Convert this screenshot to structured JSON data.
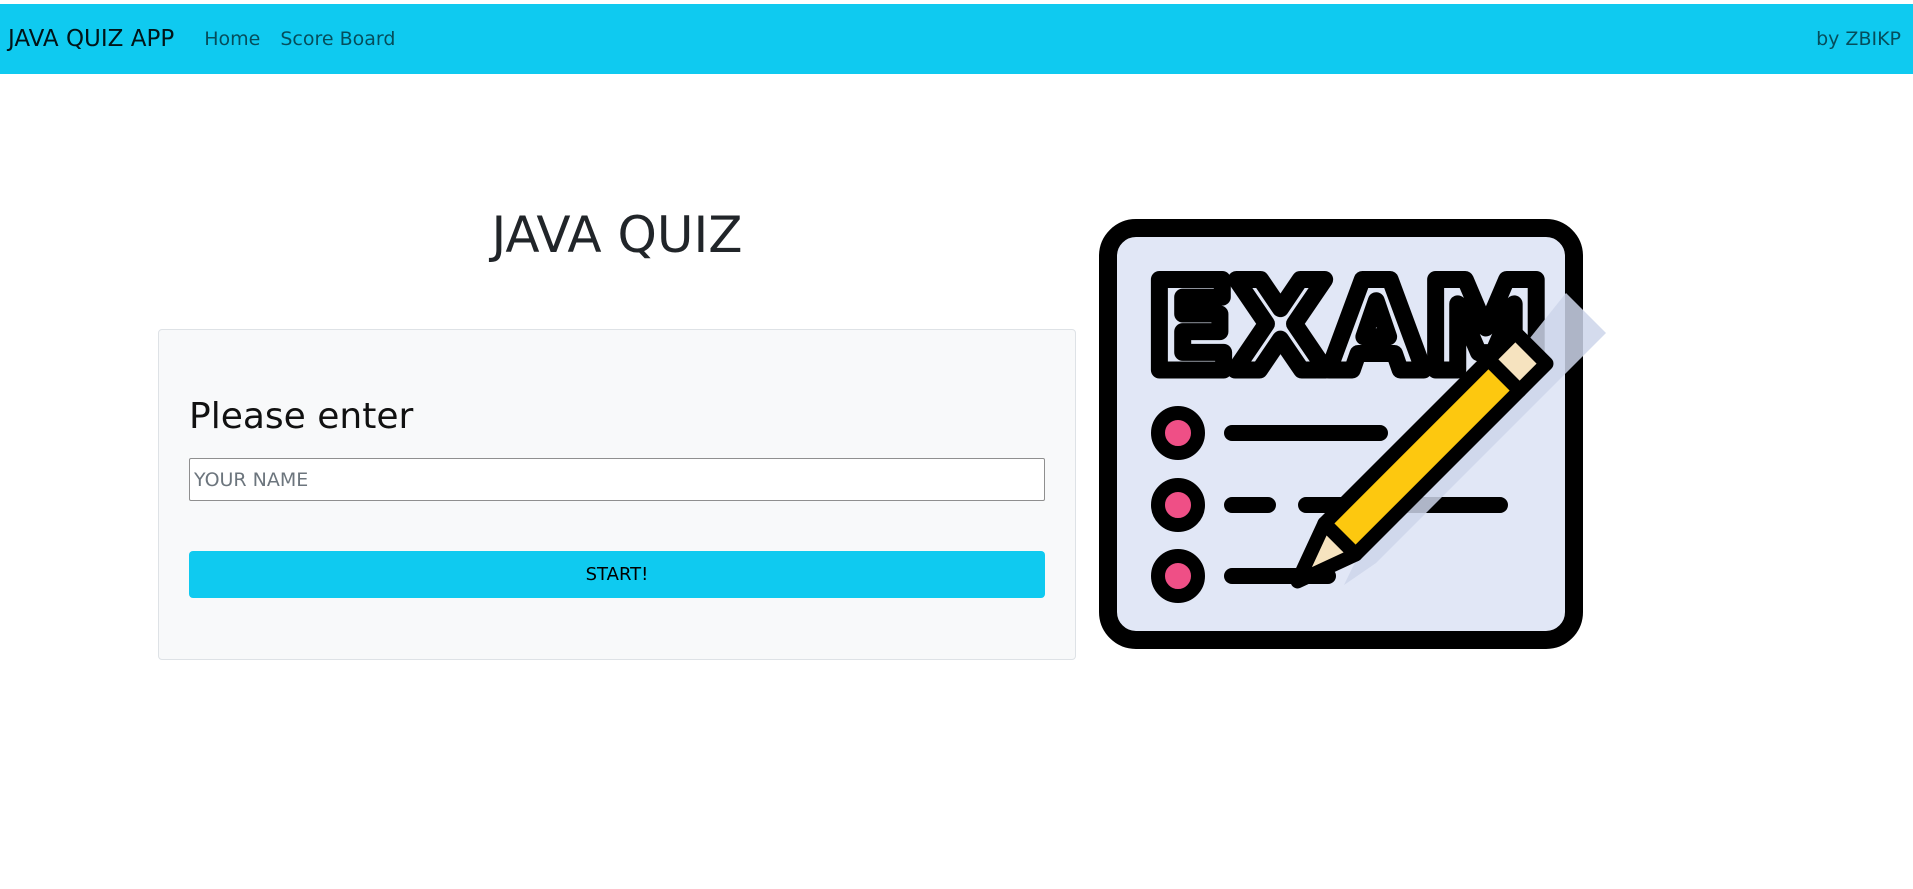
{
  "navbar": {
    "brand": "JAVA QUIZ APP",
    "links": [
      "Home",
      "Score Board"
    ],
    "author": "by ZBIKP",
    "background": "#0fcaf0"
  },
  "main": {
    "title": "JAVA QUIZ",
    "card": {
      "heading": "Please enter",
      "name_placeholder": "YOUR NAME",
      "name_value": "",
      "start_label": "START!"
    }
  },
  "illustration": {
    "text": "EXAM",
    "icon": "exam-pencil-icon",
    "colors": {
      "paper": "#e1e7f6",
      "outline": "#000000",
      "bullet": "#ef4f86",
      "pencil": "#fdc80f",
      "pencil_tip": "#f6e3bf",
      "shadow": "#cdd5ea"
    }
  }
}
